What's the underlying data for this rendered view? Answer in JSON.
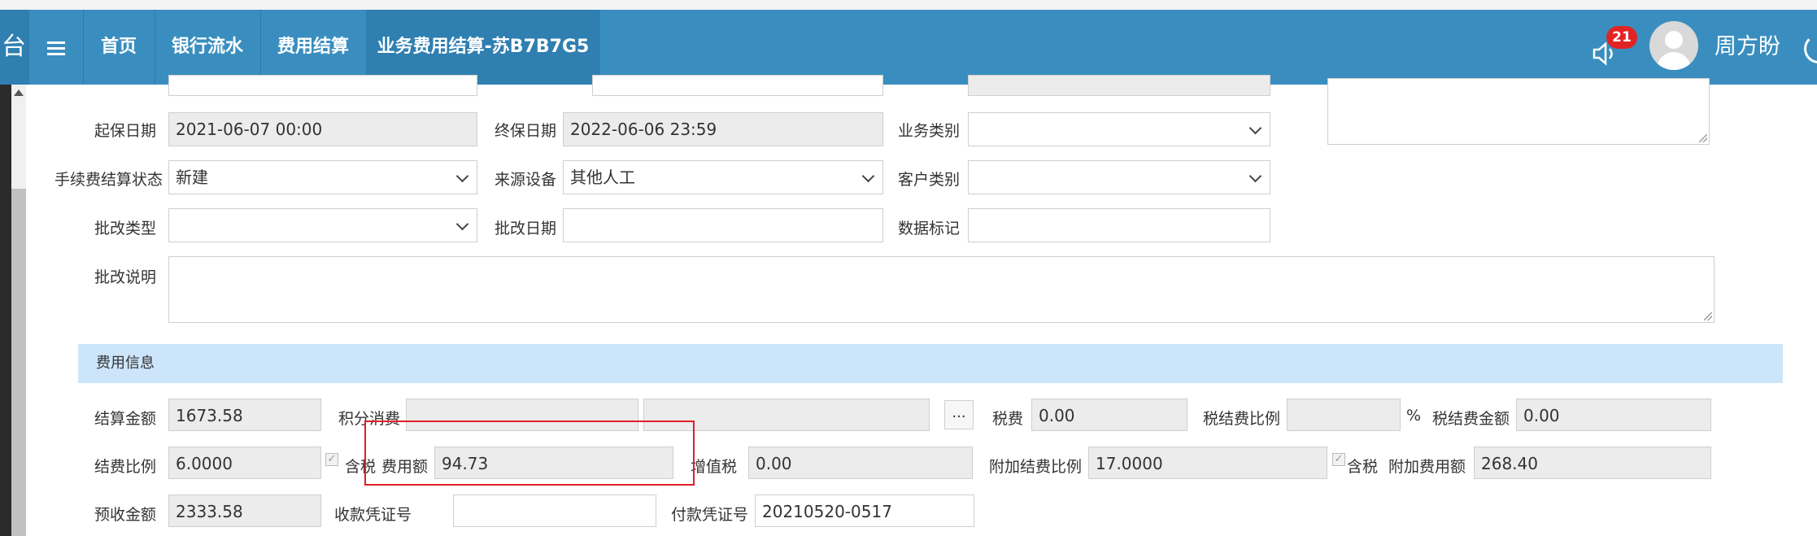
{
  "nav": {
    "left_stub": "台",
    "items": [
      {
        "label": "首页"
      },
      {
        "label": "银行流水"
      },
      {
        "label": "费用结算"
      },
      {
        "label": "业务费用结算-苏B7B7G5"
      }
    ],
    "badge_count": "21",
    "username": "周方盼"
  },
  "form": {
    "start_date_label": "起保日期",
    "start_date_value": "2021-06-07 00:00",
    "end_date_label": "终保日期",
    "end_date_value": "2022-06-06 23:59",
    "business_type_label": "业务类别",
    "business_type_value": "",
    "fee_status_label": "手续费结算状态",
    "fee_status_value": "新建",
    "source_device_label": "来源设备",
    "source_device_value": "其他人工",
    "customer_type_label": "客户类别",
    "customer_type_value": "",
    "endorse_type_label": "批改类型",
    "endorse_type_value": "",
    "endorse_date_label": "批改日期",
    "endorse_date_value": "",
    "data_mark_label": "数据标记",
    "data_mark_value": "",
    "endorse_desc_label": "批改说明",
    "endorse_desc_value": ""
  },
  "fee_section": {
    "title": "费用信息",
    "settle_amount_label": "结算金额",
    "settle_amount_value": "1673.58",
    "points_label": "积分消费",
    "points_value": "",
    "points_extra_value": "",
    "dots_label": "...",
    "tax_label": "税费",
    "tax_value": "0.00",
    "tax_ratio_label": "税结费比例",
    "tax_ratio_value": "",
    "tax_ratio_unit": "%",
    "tax_settle_label": "税结费金额",
    "tax_settle_value": "0.00",
    "fee_ratio_label": "结费比例",
    "fee_ratio_value": "6.0000",
    "tax_incl_label": "含税",
    "fee_amount_label": "费用额",
    "fee_amount_value": "94.73",
    "vat_label": "增值税",
    "vat_value": "0.00",
    "extra_ratio_label": "附加结费比例",
    "extra_ratio_value": "17.0000",
    "tax_incl_label2": "含税",
    "extra_amount_label": "附加费用额",
    "extra_amount_value": "268.40",
    "prepaid_label": "预收金额",
    "prepaid_value": "2333.58",
    "receipt_voucher_label": "收款凭证号",
    "receipt_voucher_value": "",
    "payment_voucher_label": "付款凭证号",
    "payment_voucher_value": "20210520-0517"
  }
}
